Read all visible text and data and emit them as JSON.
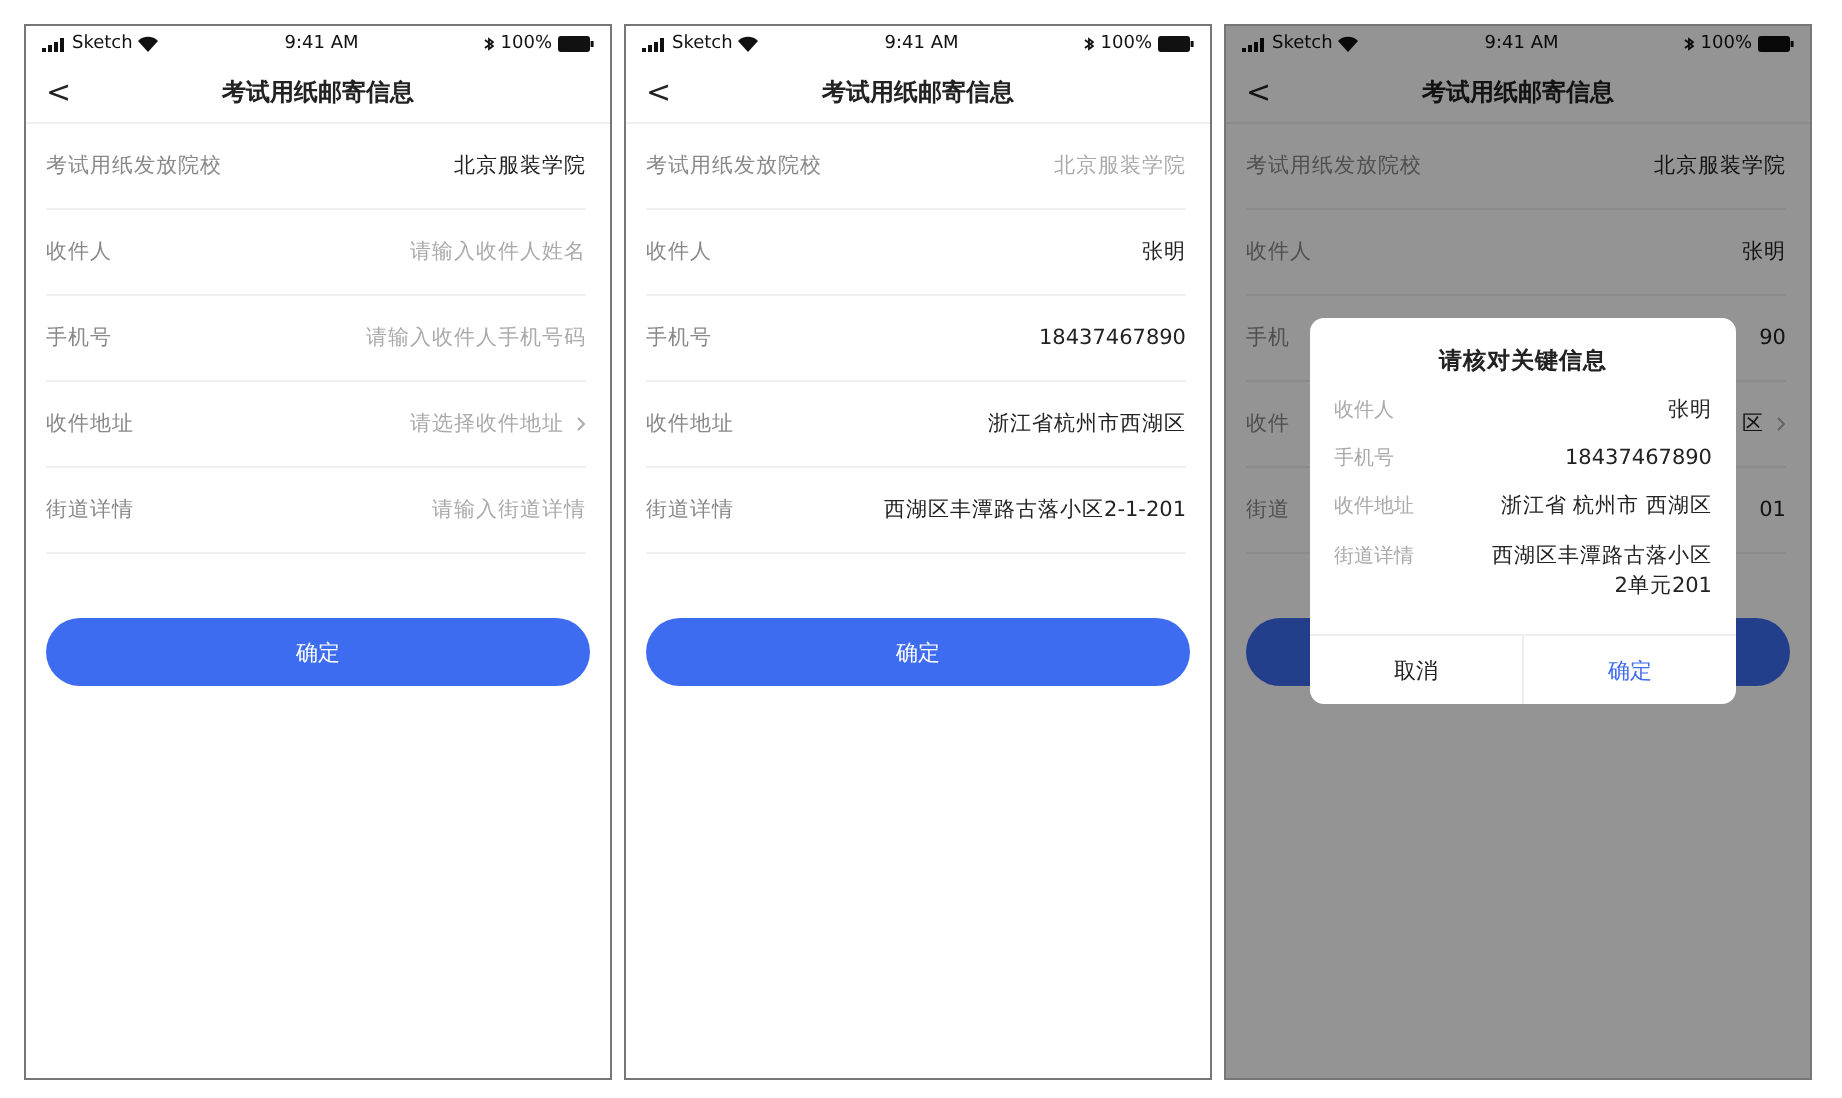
{
  "screens": [
    {
      "status_bar": {
        "carrier": "Sketch",
        "time": "9:41 AM",
        "battery": "100%"
      },
      "nav": {
        "back": "<",
        "title": "考试用纸邮寄信息"
      },
      "dimmed": false,
      "rows": [
        {
          "kind": "text",
          "label": "考试用纸发放院校",
          "value": "北京服装学院",
          "muted": false
        },
        {
          "kind": "input",
          "label": "收件人",
          "placeholder": "请输入收件人姓名"
        },
        {
          "kind": "input",
          "label": "手机号",
          "placeholder": "请输入收件人手机号码"
        },
        {
          "kind": "select",
          "label": "收件地址",
          "placeholder": "请选择收件地址"
        },
        {
          "kind": "input",
          "label": "街道详情",
          "placeholder": "请输入街道详情"
        }
      ],
      "button": {
        "label": "确定"
      }
    },
    {
      "status_bar": {
        "carrier": "Sketch",
        "time": "9:41 AM",
        "battery": "100%"
      },
      "nav": {
        "back": "<",
        "title": "考试用纸邮寄信息"
      },
      "dimmed": false,
      "rows": [
        {
          "kind": "text",
          "label": "考试用纸发放院校",
          "value": "北京服装学院",
          "muted": true
        },
        {
          "kind": "input",
          "label": "收件人",
          "value": "张明"
        },
        {
          "kind": "input",
          "label": "手机号",
          "value": "18437467890"
        },
        {
          "kind": "input",
          "label": "收件地址",
          "value": "浙江省杭州市西湖区"
        },
        {
          "kind": "input",
          "label": "街道详情",
          "value": "西湖区丰潭路古落小区2-1-201"
        }
      ],
      "button": {
        "label": "确定"
      }
    },
    {
      "status_bar": {
        "carrier": "Sketch",
        "time": "9:41 AM",
        "battery": "100%"
      },
      "nav": {
        "back": "<",
        "title": "考试用纸邮寄信息"
      },
      "dimmed": true,
      "rows": [
        {
          "kind": "text",
          "label": "考试用纸发放院校",
          "value": "北京服装学院",
          "muted": false
        },
        {
          "kind": "text",
          "label": "收件人",
          "value": "张明",
          "muted": false
        },
        {
          "kind": "text",
          "label": "手机",
          "value": "90",
          "muted": false
        },
        {
          "kind": "select",
          "label": "收件",
          "value": "区"
        },
        {
          "kind": "text",
          "label": "街道",
          "value": "01",
          "muted": false
        }
      ],
      "dialog": {
        "title": "请核对关键信息",
        "rows": [
          {
            "label": "收件人",
            "value": "张明"
          },
          {
            "label": "手机号",
            "value": "18437467890"
          },
          {
            "label": "收件地址",
            "value": "浙江省 杭州市 西湖区"
          },
          {
            "label": "街道详情",
            "value": "西湖区丰潭路古落小区2单元201"
          }
        ],
        "cancel": "取消",
        "confirm": "确定"
      }
    }
  ]
}
